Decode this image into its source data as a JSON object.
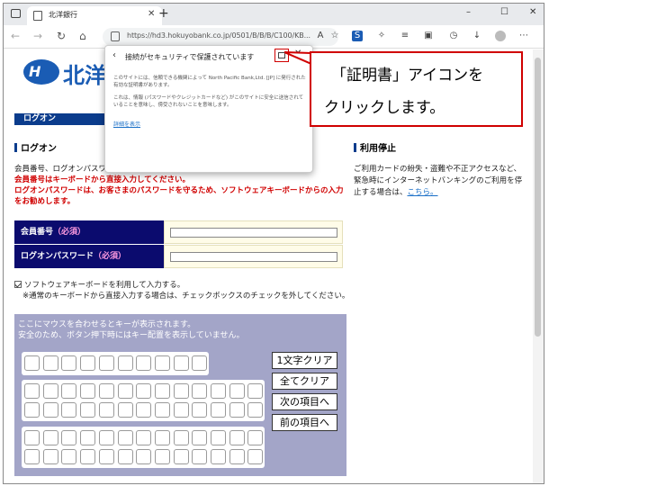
{
  "browser": {
    "tab_title": "北洋銀行",
    "new_tab": "+",
    "url": "https://hd3.hokuyobank.co.jp/0501/B/B/B/C100/KB...",
    "minimize": "–",
    "maximize": "☐",
    "close": "✕"
  },
  "page": {
    "logo_text": "北洋",
    "logon_bar": "ログオン",
    "logon_heading": "ログオン",
    "intro": "会員番号、ログオンパスワードを入力し「ログオン」ボタンを押してください。",
    "warn1": "会員番号はキーボードから直接入力してください。",
    "warn2": "ログオンパスワードは、お客さまのパスワードを守るため、ソフトウェアキーボードからの入力をお勧めします。",
    "member_no_label": "会員番号",
    "password_label": "ログオンパスワード",
    "required": "（必須）",
    "sw_kbd_check": "ソフトウェアキーボードを利用して入力する。",
    "sw_kbd_note": "※通常のキーボードから直接入力する場合は、チェックボックスのチェックを外してください。",
    "kbd_msg1": "ここにマウスを合わせるとキーが表示されます。",
    "kbd_msg2": "安全のため、ボタン押下時にはキー配置を表示していません。",
    "btn_clear1": "1文字クリア",
    "btn_clear_all": "全てクリア",
    "btn_next": "次の項目へ",
    "btn_prev": "前の項目へ",
    "stop_heading": "利用停止",
    "stop_text": "ご利用カードの紛失・盗難や不正アクセスなど、緊急時にインターネットバンキングのご利用を停止する場合は、",
    "stop_link": "こちら。"
  },
  "popup": {
    "title": "接続がセキュリティで保護されています",
    "para1": "このサイトには、信頼できる機関によって North Pacific Bank,Ltd. [JP] に発行された有効な証明書があります。",
    "para2": "これは、情報 (パスワードやクレジットカードなど) がこのサイトに安全に送信されていることを意味し、傍受されないことを意味します。",
    "more": "詳細を表示"
  },
  "callout": {
    "line1": "「証明書」アイコンを",
    "line2": "クリックします。"
  },
  "colors": {
    "brand_blue": "#1a5cb4",
    "dark_navy": "#0b0b6e",
    "highlight_red": "#d00000",
    "keyboard_bg": "#a3a5c8"
  }
}
